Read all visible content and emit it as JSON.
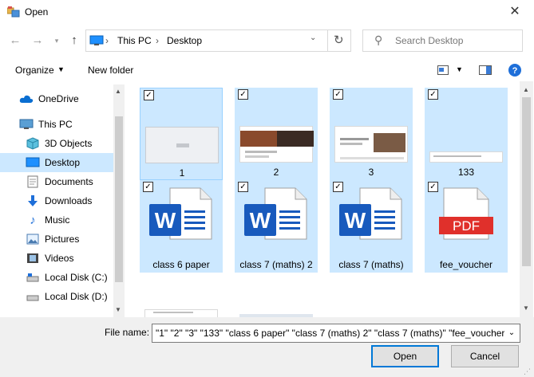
{
  "window": {
    "title": "Open"
  },
  "address": {
    "root": "This PC",
    "folder": "Desktop"
  },
  "search": {
    "placeholder": "Search Desktop"
  },
  "toolbar": {
    "organize_label": "Organize",
    "new_folder_label": "New folder"
  },
  "navigation": [
    {
      "label": "OneDrive",
      "icon": "onedrive-icon"
    },
    {
      "label": "This PC",
      "icon": "computer-icon"
    },
    {
      "label": "3D Objects",
      "icon": "3d-objects-icon"
    },
    {
      "label": "Desktop",
      "icon": "desktop-icon",
      "selected": true
    },
    {
      "label": "Documents",
      "icon": "documents-icon"
    },
    {
      "label": "Downloads",
      "icon": "downloads-icon"
    },
    {
      "label": "Music",
      "icon": "music-icon"
    },
    {
      "label": "Pictures",
      "icon": "pictures-icon"
    },
    {
      "label": "Videos",
      "icon": "videos-icon"
    },
    {
      "label": "Local Disk (C:)",
      "icon": "drive-icon"
    },
    {
      "label": "Local Disk (D:)",
      "icon": "drive-icon"
    }
  ],
  "files": [
    {
      "name": "1",
      "kind": "image",
      "checked": true
    },
    {
      "name": "2",
      "kind": "image",
      "checked": true
    },
    {
      "name": "3",
      "kind": "image",
      "checked": true
    },
    {
      "name": "133",
      "kind": "image",
      "checked": true
    },
    {
      "name": "class 6 paper",
      "kind": "word",
      "checked": true
    },
    {
      "name": "class 7 (maths) 2",
      "kind": "word",
      "checked": true
    },
    {
      "name": "class 7 (maths)",
      "kind": "word",
      "checked": true
    },
    {
      "name": "fee_voucher",
      "kind": "pdf",
      "checked": true
    }
  ],
  "pdf_badge": "PDF",
  "word_badge": "W",
  "footer": {
    "file_name_label": "File name:",
    "file_name_value": "\"1\" \"2\" \"3\" \"133\" \"class 6 paper\" \"class 7 (maths) 2\" \"class 7 (maths)\" \"fee_voucher\"",
    "open_label": "Open",
    "cancel_label": "Cancel"
  },
  "colors": {
    "selection": "#cce8ff",
    "word_blue": "#185abd",
    "pdf_red": "#e0302b",
    "accent": "#0078d7"
  }
}
